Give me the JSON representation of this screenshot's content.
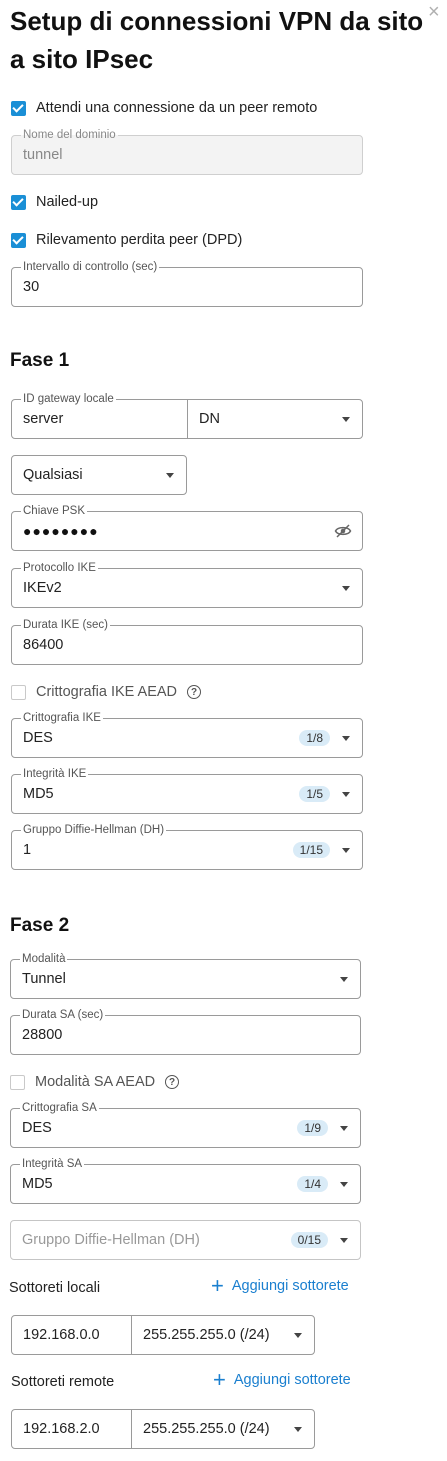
{
  "header": {
    "title": "Setup di connessioni VPN da sito a sito IPsec",
    "close": "×"
  },
  "general": {
    "wait_peer": {
      "label": "Attendi una connessione da un peer remoto",
      "checked": true
    },
    "domain": {
      "label": "Nome del dominio",
      "value": "tunnel"
    },
    "nailed_up": {
      "label": "Nailed-up",
      "checked": true
    },
    "dpd": {
      "label": "Rilevamento perdita peer (DPD)",
      "checked": true
    },
    "check_interval": {
      "label": "Intervallo di controllo (sec)",
      "value": "30"
    }
  },
  "phase1": {
    "title": "Fase 1",
    "local_gateway_id": {
      "label": "ID gateway locale",
      "value": "server",
      "type": "DN"
    },
    "peer_type": {
      "value": "Qualsiasi"
    },
    "psk": {
      "label": "Chiave PSK",
      "masked": "●●●●●●●●"
    },
    "ike_protocol": {
      "label": "Protocollo IKE",
      "value": "IKEv2"
    },
    "ike_duration": {
      "label": "Durata IKE (sec)",
      "value": "86400"
    },
    "ike_aead": {
      "label": "Crittografia IKE AEAD",
      "checked": false
    },
    "ike_encryption": {
      "label": "Crittografia IKE",
      "value": "DES",
      "badge": "1/8"
    },
    "ike_integrity": {
      "label": "Integrità IKE",
      "value": "MD5",
      "badge": "1/5"
    },
    "dh_group": {
      "label": "Gruppo Diffie-Hellman (DH)",
      "value": "1",
      "badge": "1/15"
    }
  },
  "phase2": {
    "title": "Fase 2",
    "mode": {
      "label": "Modalità",
      "value": "Tunnel"
    },
    "sa_duration": {
      "label": "Durata SA (sec)",
      "value": "28800"
    },
    "sa_aead": {
      "label": "Modalità SA AEAD",
      "checked": false
    },
    "sa_encryption": {
      "label": "Crittografia SA",
      "value": "DES",
      "badge": "1/9"
    },
    "sa_integrity": {
      "label": "Integrità SA",
      "value": "MD5",
      "badge": "1/4"
    },
    "dh_group": {
      "placeholder": "Gruppo Diffie-Hellman (DH)",
      "badge": "0/15"
    }
  },
  "subnets": {
    "local": {
      "label": "Sottoreti locali",
      "add_label": "Aggiungi sottorete",
      "ip": "192.168.0.0",
      "mask": "255.255.255.0 (/24)"
    },
    "remote": {
      "label": "Sottoreti remote",
      "add_label": "Aggiungi sottorete",
      "ip": "192.168.2.0",
      "mask": "255.255.255.0 (/24)"
    }
  },
  "colors": {
    "accent": "#1a8fd6",
    "link": "#1a7fcf",
    "badge_bg": "#d9ebf7"
  }
}
